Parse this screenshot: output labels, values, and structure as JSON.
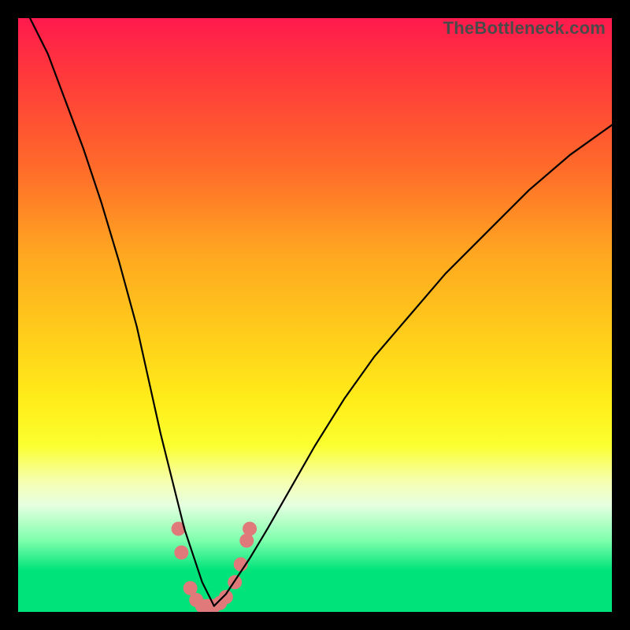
{
  "watermark": "TheBottleneck.com",
  "chart_data": {
    "type": "line",
    "title": "",
    "xlabel": "",
    "ylabel": "",
    "xlim": [
      0,
      100
    ],
    "ylim": [
      0,
      100
    ],
    "grid": false,
    "legend": false,
    "series": [
      {
        "name": "left-curve",
        "x": [
          2,
          5,
          8,
          11,
          14,
          17,
          20,
          22,
          24,
          26,
          27,
          28,
          29,
          30,
          31,
          32,
          33
        ],
        "y": [
          100,
          94,
          86,
          78,
          69,
          59,
          48,
          39,
          30,
          22,
          18,
          14,
          11,
          8,
          5,
          3,
          1
        ]
      },
      {
        "name": "right-curve",
        "x": [
          33,
          35,
          37,
          39,
          42,
          46,
          50,
          55,
          60,
          66,
          72,
          79,
          86,
          93,
          100
        ],
        "y": [
          1,
          3,
          6,
          9,
          14,
          21,
          28,
          36,
          43,
          50,
          57,
          64,
          71,
          77,
          82
        ]
      }
    ],
    "markers": {
      "name": "highlight-cluster",
      "points": [
        {
          "x": 27,
          "y": 14
        },
        {
          "x": 27.5,
          "y": 10
        },
        {
          "x": 29,
          "y": 4
        },
        {
          "x": 30,
          "y": 2
        },
        {
          "x": 31,
          "y": 1
        },
        {
          "x": 32,
          "y": 1
        },
        {
          "x": 33,
          "y": 1
        },
        {
          "x": 34,
          "y": 1.5
        },
        {
          "x": 35,
          "y": 2.5
        },
        {
          "x": 36.5,
          "y": 5
        },
        {
          "x": 37.5,
          "y": 8
        },
        {
          "x": 38.5,
          "y": 12
        },
        {
          "x": 39,
          "y": 14
        }
      ],
      "radius": 9
    },
    "gradient_stops": [
      {
        "pos": 0.0,
        "color": "#ff1a4d"
      },
      {
        "pos": 0.4,
        "color": "#ffa820"
      },
      {
        "pos": 0.7,
        "color": "#ffee1a"
      },
      {
        "pos": 0.85,
        "color": "#e6ffe0"
      },
      {
        "pos": 1.0,
        "color": "#00e37a"
      }
    ]
  }
}
